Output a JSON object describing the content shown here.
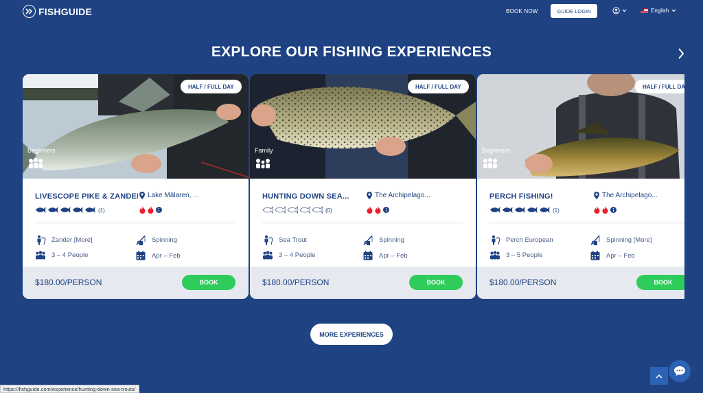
{
  "header": {
    "logo": "FISHGUIDE",
    "book_now": "BOOK NOW",
    "guide_login": "GUIDE LOGIN",
    "language": "English"
  },
  "section": {
    "title": "EXPLORE OUR FISHING EXPERIENCES"
  },
  "cards": [
    {
      "badge": "HALF / FULL DAY",
      "level": "Beginners",
      "title": "LIVESCOPE PIKE & ZANDER",
      "location": "Lake Mälaren, ...",
      "rating_count": "(1)",
      "rating": 5,
      "species": "Zander [More]",
      "method": "Spinning",
      "people": "3 – 4 People",
      "season": "Apr – Feb",
      "price": "$180.00/PERSON",
      "book": "BOOK"
    },
    {
      "badge": "HALF / FULL DAY",
      "level": "Family",
      "title": "HUNTING DOWN SEA...",
      "location": "The Archipelago...",
      "rating_count": "(0)",
      "rating": 0,
      "species": "Sea Trout",
      "method": "Spinning",
      "people": "3 – 4 People",
      "season": "Apr – Feb",
      "price": "$180.00/PERSON",
      "book": "BOOK"
    },
    {
      "badge": "HALF / FULL DAY",
      "level": "Beginners",
      "title": "PERCH FISHING!",
      "location": "The Archipelago...",
      "rating_count": "(1)",
      "rating": 5,
      "species": "Perch European",
      "method": "Spinning [More]",
      "people": "3 – 5 People",
      "season": "Apr – Feb",
      "price": "$180.00/PERSON",
      "book": "BOOK"
    }
  ],
  "more_button": "MORE EXPERIENCES",
  "status_url": "https://fishguide.com/experience/hunting-down-sea-trouts/",
  "colors": {
    "background": "#1f4283",
    "primary": "#1f4283",
    "book_green": "#2ecc5b",
    "heat_red": "#e8202a",
    "footer_gray": "#e6e9ef"
  }
}
